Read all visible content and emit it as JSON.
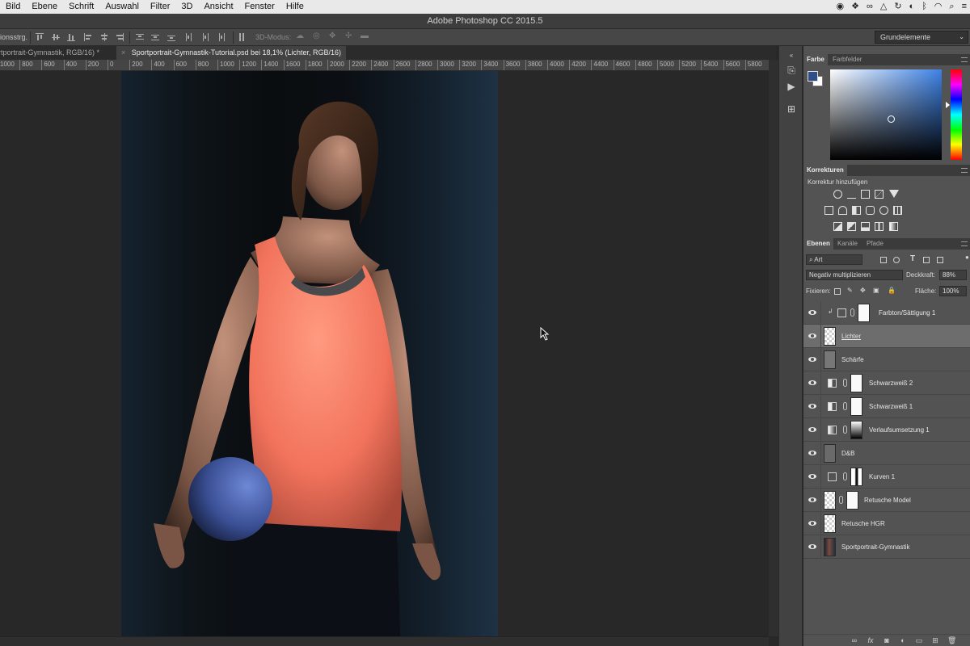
{
  "menubar": {
    "items": [
      "Bild",
      "Ebene",
      "Schrift",
      "Auswahl",
      "Filter",
      "3D",
      "Ansicht",
      "Fenster",
      "Hilfe"
    ],
    "tray_icons": [
      "record-icon",
      "dropbox-icon",
      "creative-cloud-icon",
      "drive-icon",
      "sync-icon",
      "headset-icon",
      "bluetooth-icon",
      "wifi-icon",
      "search-icon",
      "list-icon"
    ]
  },
  "window": {
    "title": "Adobe Photoshop CC 2015.5"
  },
  "options": {
    "label": "ionsstrg.",
    "mode_label": "3D-Modus:",
    "workspace": "Grundelemente"
  },
  "tabs": [
    {
      "label": "rtportrait-Gymnastik, RGB/16) *"
    },
    {
      "label": "Sportportrait-Gymnastik-Tutorial.psd bei 18,1% (Lichter, RGB/16)"
    }
  ],
  "ruler": {
    "labels": [
      "1000",
      "800",
      "600",
      "400",
      "200",
      "0",
      "200",
      "400",
      "600",
      "800",
      "1000",
      "1200",
      "1400",
      "1600",
      "1800",
      "2000",
      "2200",
      "2400",
      "2600",
      "2800",
      "3000",
      "3200",
      "3400",
      "3600",
      "3800",
      "4000",
      "4200",
      "4400",
      "4600",
      "4800",
      "5000",
      "5200",
      "5400",
      "5600",
      "5800"
    ]
  },
  "color_panel": {
    "tabs": [
      "Farbe",
      "Farbfelder"
    ],
    "foreground": "#2f4e86",
    "background": "#ffffff"
  },
  "corrections": {
    "title": "Korrekturen",
    "subtitle": "Korrektur hinzufügen"
  },
  "layers_panel": {
    "tabs": [
      "Ebenen",
      "Kanäle",
      "Pfade"
    ],
    "filter": "Art",
    "blend_mode": "Negativ multiplizieren",
    "opacity_label": "Deckkraft:",
    "opacity": "88%",
    "lock_label": "Fixieren:",
    "fill_label": "Fläche:",
    "fill": "100%",
    "layers": [
      {
        "name": "Farbton/Sättigung 1",
        "selected": false
      },
      {
        "name": "Lichter",
        "selected": true
      },
      {
        "name": "Schärfe",
        "selected": false
      },
      {
        "name": "Schwarzweiß 2",
        "selected": false
      },
      {
        "name": "Schwarzweiß 1",
        "selected": false
      },
      {
        "name": "Verlaufsumsetzung 1",
        "selected": false
      },
      {
        "name": "D&B",
        "selected": false
      },
      {
        "name": "Kurven 1",
        "selected": false
      },
      {
        "name": "Retusche Model",
        "selected": false
      },
      {
        "name": "Retusche HGR",
        "selected": false
      },
      {
        "name": "Sportportrait-Gymnastik",
        "selected": false
      }
    ]
  }
}
